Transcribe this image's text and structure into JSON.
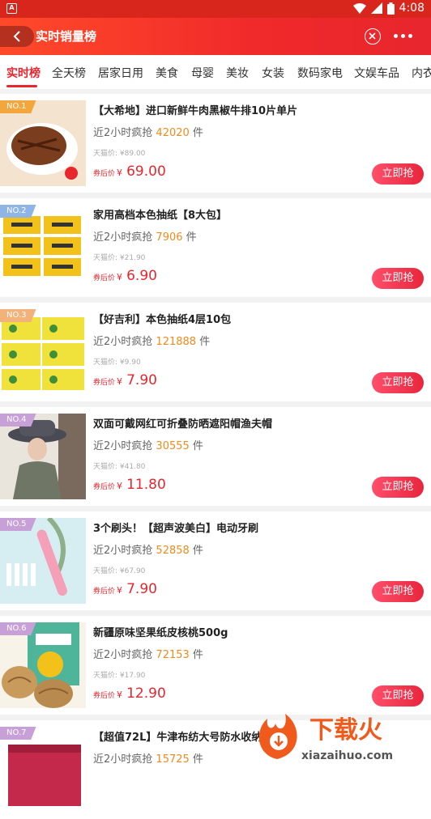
{
  "status_bar": {
    "app_glyph": "A",
    "time": "4:08"
  },
  "app_bar": {
    "title": "实时销量榜"
  },
  "tabs": [
    "实时榜",
    "全天榜",
    "居家日用",
    "美食",
    "母婴",
    "美妆",
    "女装",
    "数码家电",
    "文娱车品",
    "内衣"
  ],
  "active_tab": 0,
  "colors": {
    "accent": "#e8262e",
    "count": "#f08a1c"
  },
  "labels": {
    "sales_prefix": "近2小时疯抢",
    "sales_suffix": "件",
    "orig_prefix": "天猫价: ¥",
    "after_label": "券后价",
    "currency": "¥",
    "buy_button": "立即抢"
  },
  "products": [
    {
      "rank": "NO.1",
      "name": "【大希地】进口新鲜牛肉黑椒牛排10片单片",
      "sold": "42020",
      "original_price": "89.00",
      "coupon_price": "69.00",
      "thumb_icon": "steak-image",
      "rank_color": "#f2a63b"
    },
    {
      "rank": "NO.2",
      "name": "家用高档本色抽纸【8大包】",
      "sold": "7906",
      "original_price": "21.90",
      "coupon_price": "6.90",
      "thumb_icon": "tissue-box-image",
      "rank_color": "#8fb4e6"
    },
    {
      "rank": "NO.3",
      "name": "【好吉利】本色抽纸4层10包",
      "sold": "121888",
      "original_price": "9.90",
      "coupon_price": "7.90",
      "thumb_icon": "tissue-pack-image",
      "rank_color": "#f4b27b"
    },
    {
      "rank": "NO.4",
      "name": "双面可戴网红可折叠防晒遮阳帽渔夫帽",
      "sold": "30555",
      "original_price": "41.80",
      "coupon_price": "11.80",
      "thumb_icon": "bucket-hat-image",
      "rank_color": "#c7a0d8"
    },
    {
      "rank": "NO.5",
      "name": "3个刷头！【超声波美白】电动牙刷",
      "sold": "52858",
      "original_price": "67.90",
      "coupon_price": "7.90",
      "thumb_icon": "toothbrush-image",
      "rank_color": "#c7a0d8"
    },
    {
      "rank": "NO.6",
      "name": "新疆原味坚果纸皮核桃500g",
      "sold": "72153",
      "original_price": "17.90",
      "coupon_price": "12.90",
      "thumb_icon": "walnut-image",
      "rank_color": "#c7a0d8"
    },
    {
      "rank": "NO.7",
      "name": "【超值72L】牛津布纺大号防水收纳箱",
      "sold": "15725",
      "original_price": "",
      "coupon_price": "",
      "thumb_icon": "storage-box-image",
      "rank_color": "#c7a0d8"
    }
  ],
  "watermark": {
    "text": "下载火",
    "url": "xiazaihuo.com"
  }
}
